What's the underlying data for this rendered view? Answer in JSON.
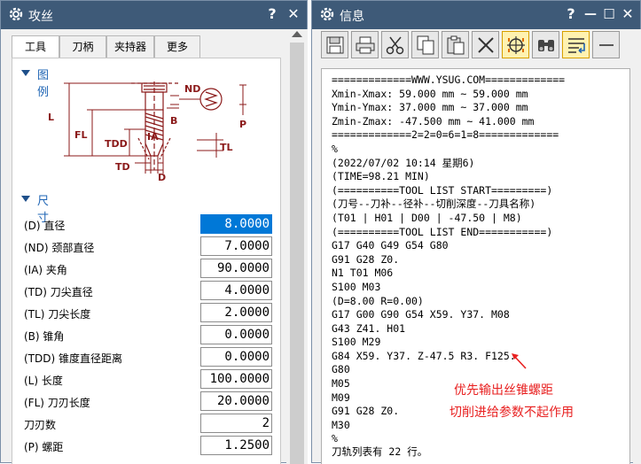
{
  "left_window": {
    "title": "攻丝",
    "help": "?",
    "close": "✕",
    "tabs": [
      "工具",
      "刀柄",
      "夹持器",
      "更多"
    ],
    "legend_section": "图例",
    "size_section": "尺寸",
    "diagram_labels": {
      "nd": "ND",
      "l": "L",
      "fl": "FL",
      "b": "B",
      "p": "P",
      "tdd": "TDD",
      "ia": "IA",
      "tl": "TL",
      "td": "TD",
      "d": "D"
    },
    "params": [
      {
        "label": "(D) 直径",
        "value": "8.0000",
        "selected": true
      },
      {
        "label": "(ND) 颈部直径",
        "value": "7.0000"
      },
      {
        "label": "(IA) 夹角",
        "value": "90.0000"
      },
      {
        "label": "(TD) 刀尖直径",
        "value": "4.0000"
      },
      {
        "label": "(TL) 刀尖长度",
        "value": "2.0000"
      },
      {
        "label": "(B) 锥角",
        "value": "0.0000"
      },
      {
        "label": "(TDD) 锥度直径距离",
        "value": "0.0000"
      },
      {
        "label": "(L) 长度",
        "value": "100.0000"
      },
      {
        "label": "(FL) 刀刃长度",
        "value": "20.0000"
      },
      {
        "label": "刀刃数",
        "value": "2"
      },
      {
        "label": "(P) 螺距",
        "value": "1.2500"
      }
    ]
  },
  "right_window": {
    "title": "信息",
    "help": "?",
    "minimize": "—",
    "maximize": "☐",
    "close": "✕",
    "toolbar": [
      "save-icon",
      "print-icon",
      "cut-icon",
      "copy-icon",
      "paste-icon",
      "delete-icon",
      "find-target-icon",
      "binoculars-icon",
      "wrap-icon",
      "minus-icon"
    ],
    "lines": [
      "=============WWW.YSUG.COM=============",
      "Xmin-Xmax: 59.000 mm ~ 59.000 mm",
      "Ymin-Ymax: 37.000 mm ~ 37.000 mm",
      "Zmin-Zmax: -47.500 mm ~ 41.000 mm",
      "=============2=2=0=6=1=8=============",
      "%",
      "(2022/07/02 10:14 星期6)",
      "(TIME=98.21 MIN)",
      "(==========TOOL LIST START=========)",
      "(刀号--刀补--径补--切削深度--刀具名称)",
      "(T01 | H01 | D00 | -47.50 | M8)",
      "(==========TOOL LIST END===========)",
      "G17 G40 G49 G54 G80",
      "G91 G28 Z0.",
      "N1 T01 M06",
      "S100 M03",
      "(D=8.00 R=0.00)",
      "G17 G00 G90 G54 X59. Y37. M08",
      "G43 Z41. H01",
      "S100 M29",
      "G84 X59. Y37. Z-47.5 R3. F125.",
      "G80",
      "M05",
      "M09",
      "G91 G28 Z0.",
      "M30",
      "%"
    ],
    "footer": "刀轨列表有 22 行。",
    "annotation_line1": "优先输出丝锥螺距",
    "annotation_line2": "切削进给参数不起作用"
  },
  "colors": {
    "titlebar": "#3e5a78",
    "section": "#1e64b4",
    "annotation": "#e82020",
    "diagram": "#8b1a1a",
    "selection": "#0078d7"
  }
}
